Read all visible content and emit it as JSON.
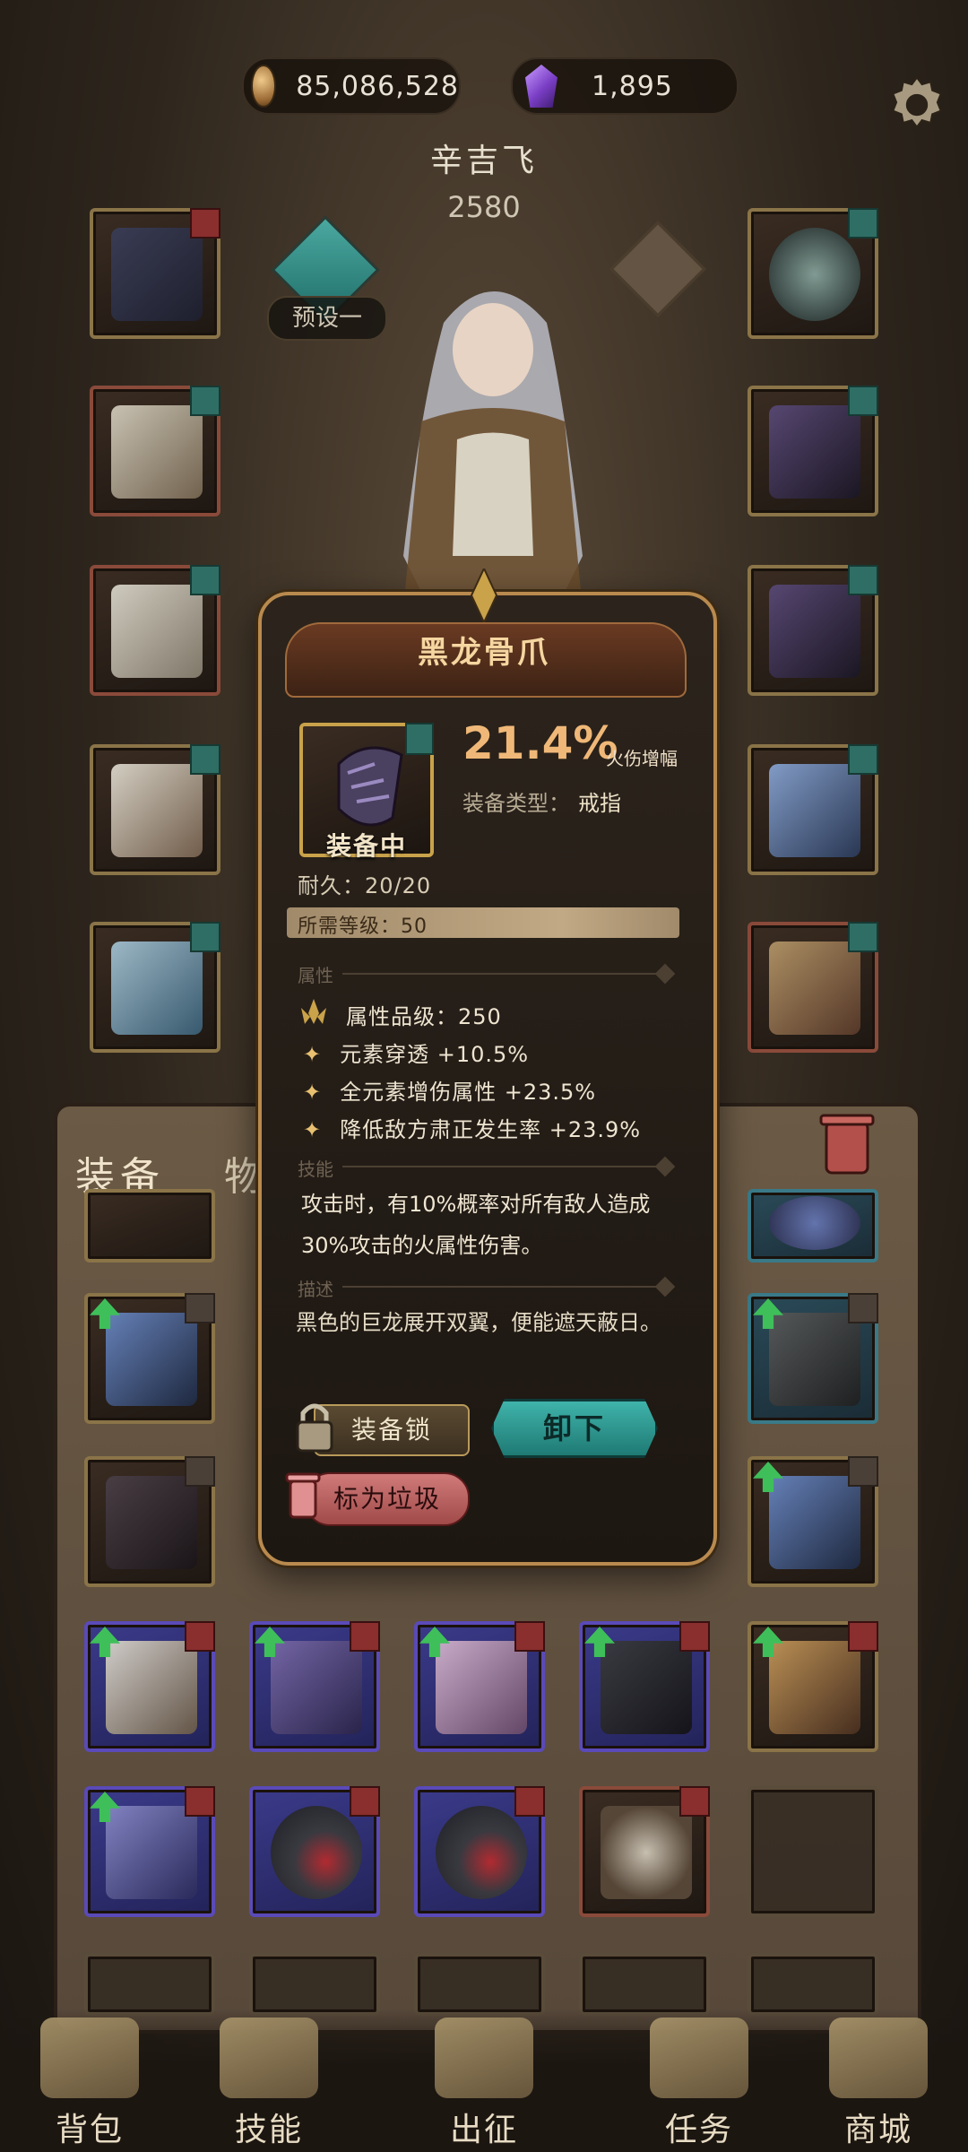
{
  "header": {
    "gold": "85,086,528",
    "gems": "1,895",
    "hero_name": "辛吉飞",
    "hero_power": "2580",
    "preset_label": "预设一"
  },
  "bag": {
    "tab_equip": "装备",
    "tab_items": "物品"
  },
  "popup": {
    "title": "黑龙骨爪",
    "equipped_label": "装备中",
    "main_stat_value": "21.4%",
    "main_stat_label": "火伤增幅",
    "type_label": "装备类型：",
    "type_value": "戒指",
    "durability": "耐久：20/20",
    "level_req": "所需等级：50",
    "section_attr": "属性",
    "attr_grade": "属性品级：250",
    "attrs": [
      "元素穿透 +10.5%",
      "全元素增伤属性 +23.5%",
      "降低敌方肃正发生率 +23.9%"
    ],
    "section_skill": "技能",
    "skill_text": "攻击时，有10%概率对所有敌人造成30%攻击的火属性伤害。",
    "section_desc": "描述",
    "desc_text": "黑色的巨龙展开双翼，便能遮天蔽日。",
    "btn_lock": "装备锁",
    "btn_unequip": "卸下",
    "btn_junk": "标为垃圾"
  },
  "nav": {
    "bag": "背包",
    "skills": "技能",
    "expedition": "出征",
    "tasks": "任务",
    "shop": "商城"
  },
  "icons": {
    "gold": "coin-icon",
    "gem": "purple-gem-icon",
    "settings": "gear-icon",
    "trash": "trash-icon",
    "lock": "lock-icon",
    "upgrade": "green-up-arrow-icon"
  },
  "colors": {
    "accent_gold": "#b98a4e",
    "stat_orange": "#f0b878",
    "unequip_teal": "#3fb3aa",
    "junk_red": "#d07a7a",
    "upgrade_green": "#3fbf5a"
  }
}
